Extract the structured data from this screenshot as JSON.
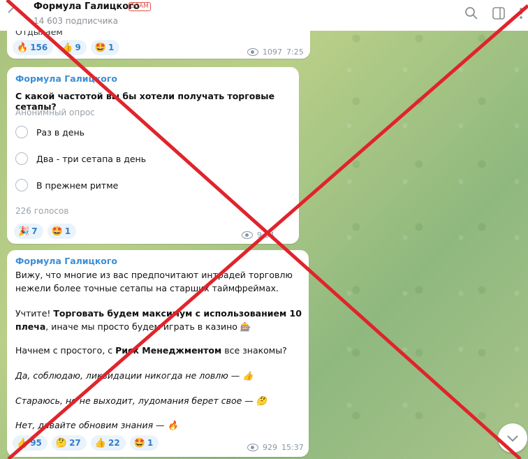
{
  "header": {
    "title": "Формула Галицкого",
    "badge": "SCAM",
    "subtitle": "14 603 подписчика"
  },
  "msg1": {
    "partial_text": "Отдыхаем",
    "reactions": [
      {
        "emoji": "🔥",
        "count": "156"
      },
      {
        "emoji": "👍",
        "count": "9"
      },
      {
        "emoji": "🤩",
        "count": "1"
      }
    ],
    "views": "1097",
    "time": "7:25"
  },
  "poll": {
    "sender": "Формула Галицкого",
    "question": "С какой частотой вы бы хотели получать торговые сетапы?",
    "type": "Анонимный опрос",
    "options": [
      "Раз в день",
      "Два - три сетапа в день",
      "В прежнем ритме"
    ],
    "votes": "226 голосов",
    "reactions": [
      {
        "emoji": "🎉",
        "count": "7"
      },
      {
        "emoji": "🤩",
        "count": "1"
      }
    ],
    "time": "9:34"
  },
  "msg3": {
    "sender": "Формула Галицкого",
    "p1": "Вижу, что многие из вас предпочитают интрадей торговлю нежели более точные сетапы на старших таймфреймах.",
    "p2_a": "Учтите! ",
    "p2_b": "Торговать будем максимум с использованием 10 плеча",
    "p2_c": ", иначе мы просто будем играть в казино 🎰",
    "p3_a": "Начнем с простого, с ",
    "p3_b": "Риск Менеджментом",
    "p3_c": " все знакомы?",
    "p4": "Да, соблюдаю, ликвидации никогда не ловлю — 👍",
    "p5": "Стараюсь, но не выходит, лудомания берет свое — 🤔",
    "p6": "Нет, давайте обновим знания — 🔥",
    "reactions": [
      {
        "emoji": "👍",
        "count": "95"
      },
      {
        "emoji": "🤔",
        "count": "27"
      },
      {
        "emoji": "👍",
        "count": "22"
      },
      {
        "emoji": "🤩",
        "count": "1"
      }
    ],
    "views": "929",
    "time": "15:37"
  },
  "colors": {
    "accent": "#3a8fd6",
    "cross": "#e0242b",
    "scam": "#e0524a"
  },
  "icons": [
    "back-arrow-icon",
    "search-icon",
    "sidebar-toggle-icon",
    "more-icon",
    "chevron-down-icon",
    "eye-icon"
  ]
}
